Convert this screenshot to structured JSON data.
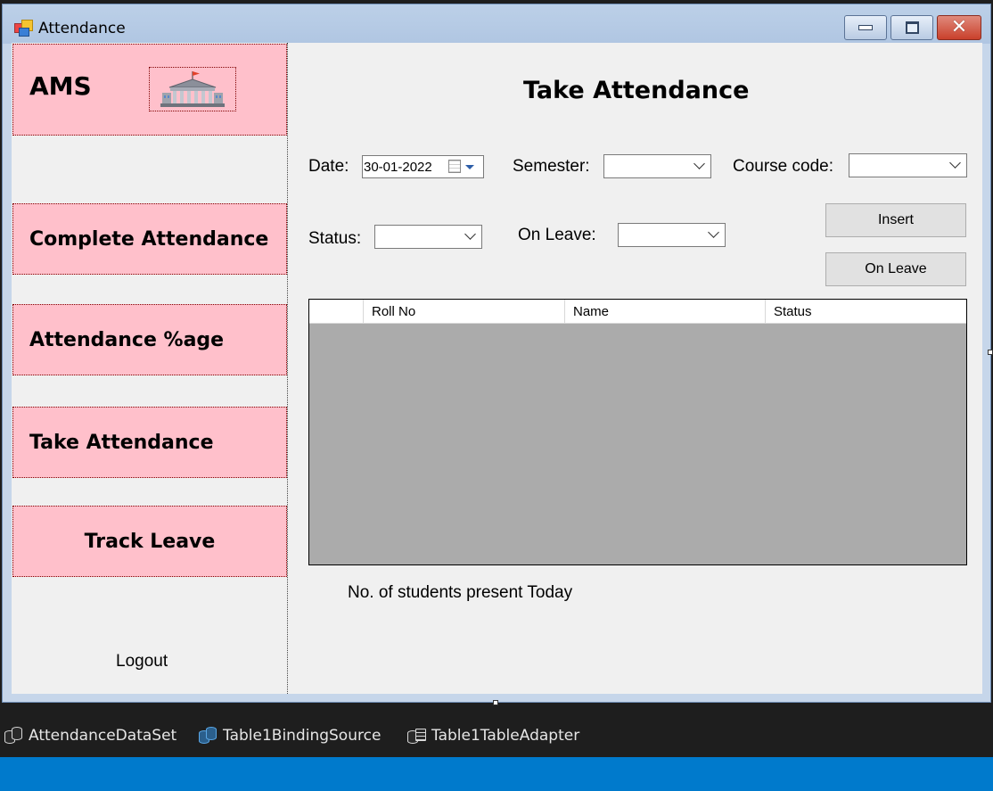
{
  "window": {
    "title": "Attendance"
  },
  "sidebar": {
    "brand": "AMS",
    "nav": [
      {
        "label": "Complete Attendance"
      },
      {
        "label": "Attendance %age"
      },
      {
        "label": "Take Attendance"
      },
      {
        "label": "Track Leave"
      }
    ],
    "logout": "Logout"
  },
  "main": {
    "title": "Take Attendance",
    "date_label": "Date:",
    "date_value": "30-01-2022",
    "semester_label": "Semester:",
    "course_label": "Course code:",
    "status_label": "Status:",
    "onleave_label": "On Leave:",
    "insert_button": "Insert",
    "onleave_button": "On Leave",
    "grid": {
      "columns": [
        "Roll No",
        "Name",
        "Status"
      ],
      "rows": []
    },
    "present_label": "No. of students present Today"
  },
  "tray": {
    "items": [
      {
        "label": "AttendanceDataSet",
        "icon": "dataset-icon"
      },
      {
        "label": "Table1BindingSource",
        "icon": "binding-source-icon"
      },
      {
        "label": "Table1TableAdapter",
        "icon": "table-adapter-icon"
      }
    ]
  },
  "colors": {
    "nav_background": "#ffc0cb",
    "nav_border": "#800000",
    "grid_background": "#ababab",
    "statusbar": "#007acc"
  }
}
